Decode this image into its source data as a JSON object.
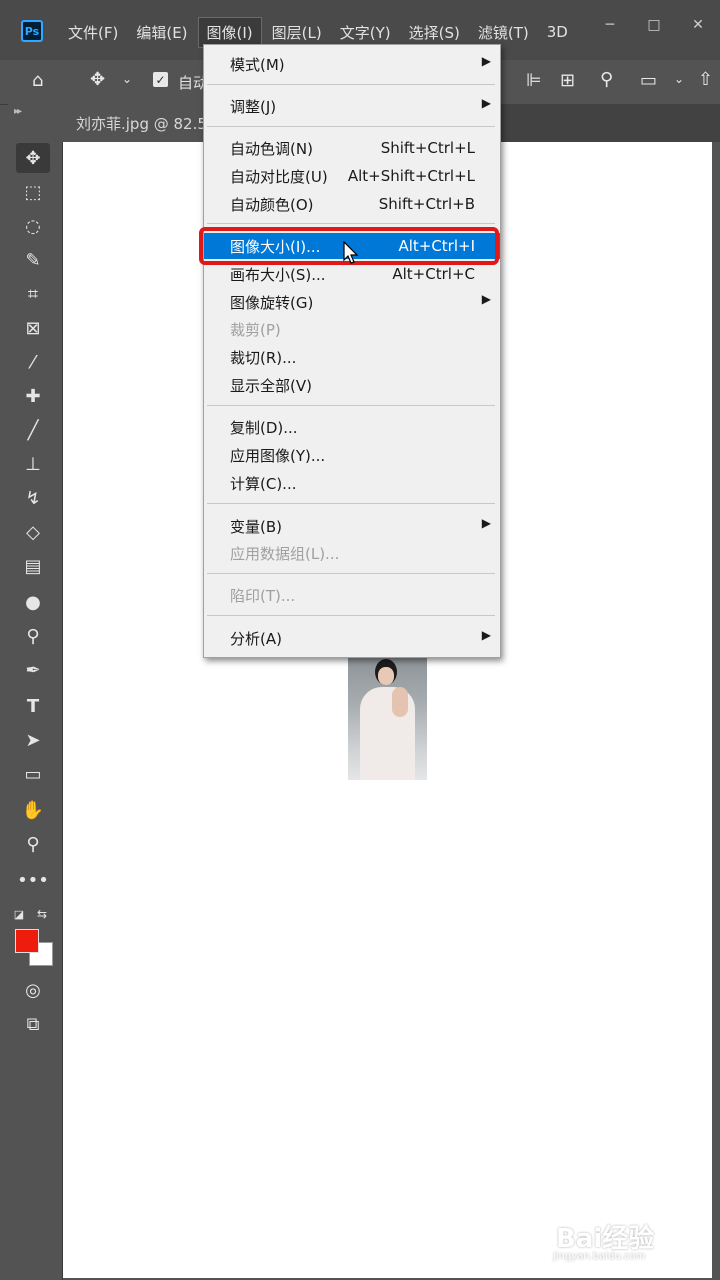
{
  "menubar": {
    "logo": "Ps",
    "items": [
      "文件(F)",
      "编辑(E)",
      "图像(I)",
      "图层(L)",
      "文字(Y)",
      "选择(S)",
      "滤镜(T)",
      "3D"
    ],
    "window_buttons": [
      "─",
      "□",
      "✕"
    ]
  },
  "options": {
    "auto_label": "自动"
  },
  "document": {
    "tab_title": "刘亦菲.jpg @ 82.5"
  },
  "image_menu": {
    "items": [
      {
        "label": "模式(M)",
        "shortcut": "",
        "submenu": true,
        "disabled": false
      },
      {
        "label": "调整(J)",
        "shortcut": "",
        "submenu": true,
        "disabled": false
      },
      {
        "label": "自动色调(N)",
        "shortcut": "Shift+Ctrl+L",
        "submenu": false,
        "disabled": false
      },
      {
        "label": "自动对比度(U)",
        "shortcut": "Alt+Shift+Ctrl+L",
        "submenu": false,
        "disabled": false
      },
      {
        "label": "自动颜色(O)",
        "shortcut": "Shift+Ctrl+B",
        "submenu": false,
        "disabled": false
      },
      {
        "label": "图像大小(I)...",
        "shortcut": "Alt+Ctrl+I",
        "submenu": false,
        "disabled": false,
        "highlighted": true
      },
      {
        "label": "画布大小(S)...",
        "shortcut": "Alt+Ctrl+C",
        "submenu": false,
        "disabled": false
      },
      {
        "label": "图像旋转(G)",
        "shortcut": "",
        "submenu": true,
        "disabled": false
      },
      {
        "label": "裁剪(P)",
        "shortcut": "",
        "submenu": false,
        "disabled": true
      },
      {
        "label": "裁切(R)...",
        "shortcut": "",
        "submenu": false,
        "disabled": false
      },
      {
        "label": "显示全部(V)",
        "shortcut": "",
        "submenu": false,
        "disabled": false
      },
      {
        "label": "复制(D)...",
        "shortcut": "",
        "submenu": false,
        "disabled": false
      },
      {
        "label": "应用图像(Y)...",
        "shortcut": "",
        "submenu": false,
        "disabled": false
      },
      {
        "label": "计算(C)...",
        "shortcut": "",
        "submenu": false,
        "disabled": false
      },
      {
        "label": "变量(B)",
        "shortcut": "",
        "submenu": true,
        "disabled": false
      },
      {
        "label": "应用数据组(L)...",
        "shortcut": "",
        "submenu": false,
        "disabled": true
      },
      {
        "label": "陷印(T)...",
        "shortcut": "",
        "submenu": false,
        "disabled": true
      },
      {
        "label": "分析(A)",
        "shortcut": "",
        "submenu": true,
        "disabled": false
      }
    ]
  },
  "colors": {
    "foreground": "#ee1c0d",
    "background": "#ffffff",
    "highlight": "#0078d7",
    "highlight_outline": "#e01818"
  },
  "watermark": {
    "brand": "Bai经验",
    "url": "jingyan.baidu.com"
  }
}
